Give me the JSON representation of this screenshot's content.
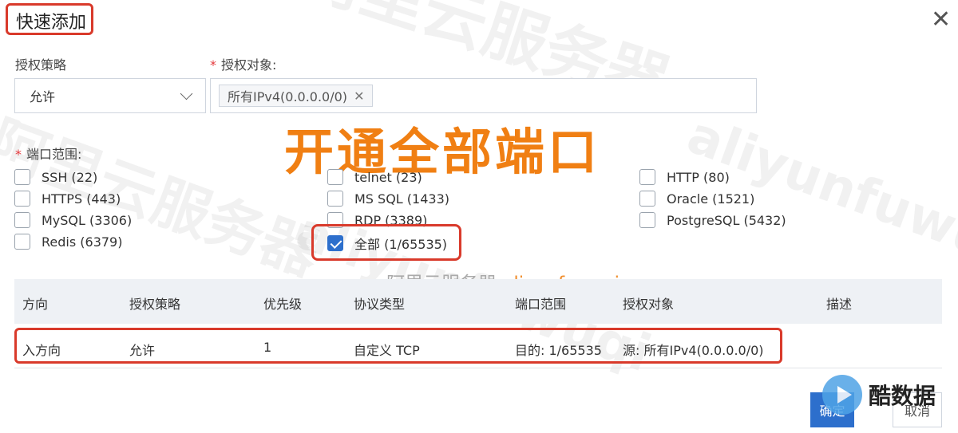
{
  "dialog": {
    "title": "快速添加"
  },
  "form": {
    "policy_label": "授权策略",
    "policy_value": "允许",
    "target_label": "授权对象:",
    "target_tag": "所有IPv4(0.0.0.0/0)",
    "port_label": "端口范围:"
  },
  "overlay": {
    "headline": "开通全部端口"
  },
  "ports": [
    {
      "label": "SSH (22)",
      "checked": false
    },
    {
      "label": "HTTPS (443)",
      "checked": false
    },
    {
      "label": "MySQL (3306)",
      "checked": false
    },
    {
      "label": "Redis (6379)",
      "checked": false
    },
    {
      "label": "telnet (23)",
      "checked": false
    },
    {
      "label": "MS SQL (1433)",
      "checked": false
    },
    {
      "label": "RDP (3389)",
      "checked": false
    },
    {
      "label": "全部 (1/65535)",
      "checked": true
    },
    {
      "label": "HTTP (80)",
      "checked": false
    },
    {
      "label": "Oracle (1521)",
      "checked": false
    },
    {
      "label": "PostgreSQL (5432)",
      "checked": false
    }
  ],
  "watermark": {
    "site": "阿里云服务器",
    "url": "aliyunfuwuqi.com",
    "latin": "aliyunfuwuqi"
  },
  "table": {
    "headers": [
      "方向",
      "授权策略",
      "优先级",
      "协议类型",
      "端口范围",
      "授权对象",
      "描述"
    ],
    "row": [
      "入方向",
      "允许",
      "1",
      "自定义 TCP",
      "目的: 1/65535",
      "源: 所有IPv4(0.0.0.0/0)",
      ""
    ]
  },
  "buttons": {
    "ok": "确定",
    "cancel": "取消"
  },
  "logo": {
    "text": "酷数据"
  },
  "colors": {
    "accent": "#2d6fcc",
    "highlight": "#d93a2b",
    "overlay": "#f07f13"
  }
}
